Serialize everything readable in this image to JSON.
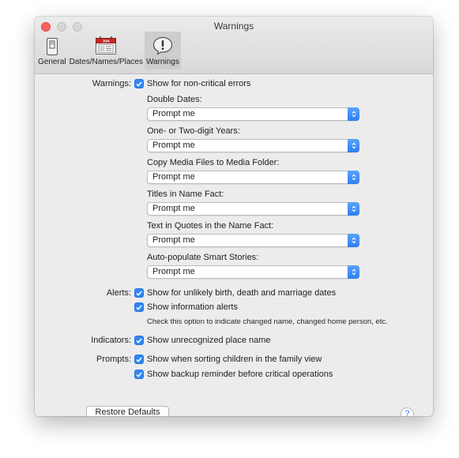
{
  "window": {
    "title": "Warnings"
  },
  "toolbar": {
    "items": [
      {
        "label": "General",
        "active": false
      },
      {
        "label": "Dates/Names/Places",
        "active": false
      },
      {
        "label": "Warnings",
        "active": true
      }
    ],
    "calendar_text": "JUN"
  },
  "warnings": {
    "label": "Warnings:",
    "checkbox": {
      "text": "Show for non-critical errors",
      "checked": true
    },
    "options": [
      {
        "heading": "Double Dates:",
        "value": "Prompt me"
      },
      {
        "heading": "One- or Two-digit Years:",
        "value": "Prompt me"
      },
      {
        "heading": "Copy Media Files to Media Folder:",
        "value": "Prompt me"
      },
      {
        "heading": "Titles in Name Fact:",
        "value": "Prompt me"
      },
      {
        "heading": "Text in Quotes in the Name Fact:",
        "value": "Prompt me"
      },
      {
        "heading": "Auto-populate Smart Stories:",
        "value": "Prompt me"
      }
    ]
  },
  "alerts": {
    "label": "Alerts:",
    "items": [
      {
        "text": "Show for unlikely birth, death and marriage dates",
        "checked": true
      },
      {
        "text": "Show information alerts",
        "checked": true
      }
    ],
    "note": "Check this option to indicate changed name, changed home person, etc."
  },
  "indicators": {
    "label": "Indicators:",
    "items": [
      {
        "text": "Show unrecognized place name",
        "checked": true
      }
    ]
  },
  "prompts": {
    "label": "Prompts:",
    "items": [
      {
        "text": "Show when sorting children in the family view",
        "checked": true
      },
      {
        "text": "Show backup reminder before critical operations",
        "checked": true
      }
    ]
  },
  "footer": {
    "restore_label": "Restore Defaults",
    "help_label": "?"
  },
  "colors": {
    "accent": "#2f86f3",
    "close": "#fc605c",
    "calendar_red": "#c92a23"
  }
}
